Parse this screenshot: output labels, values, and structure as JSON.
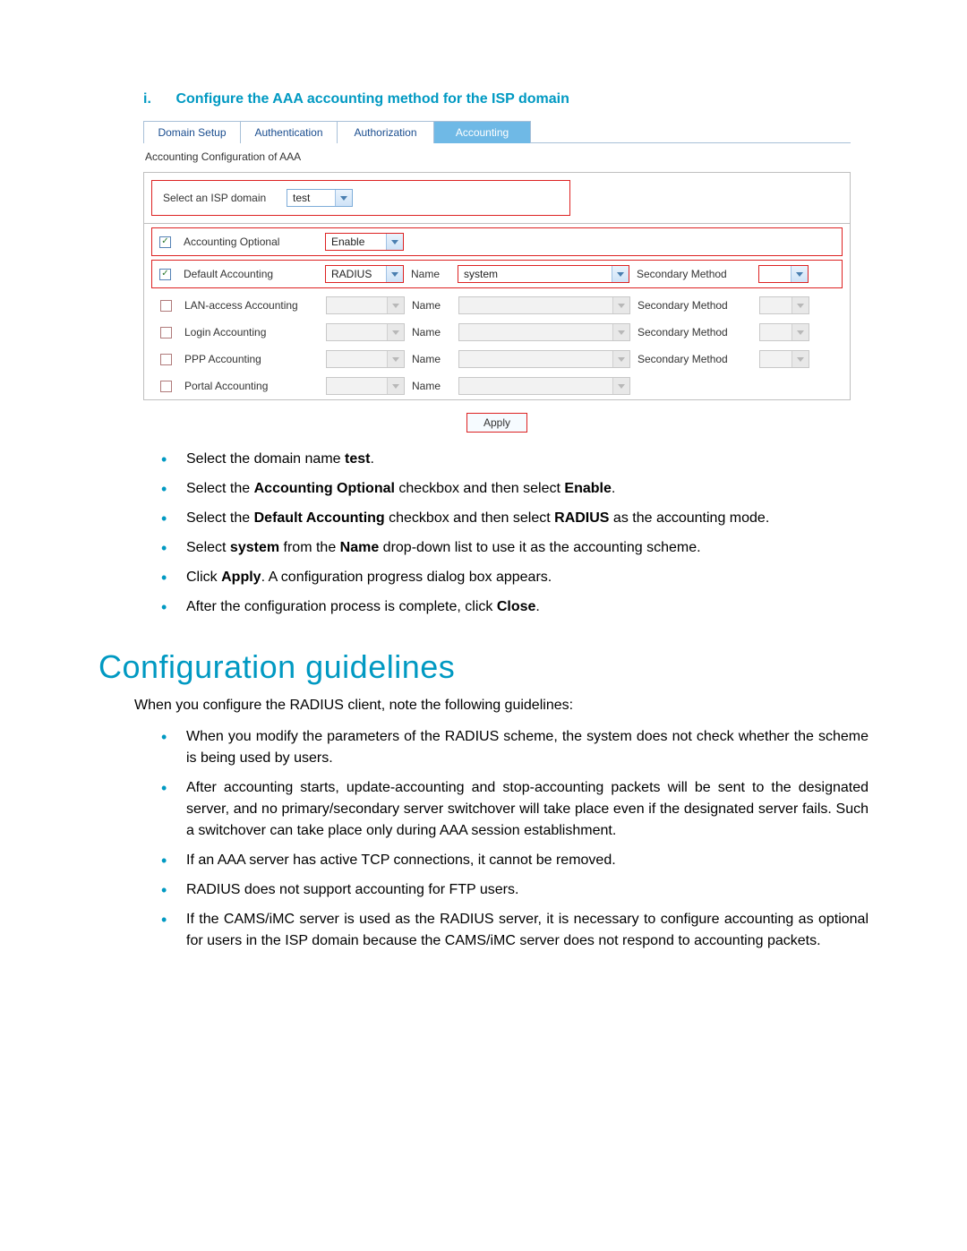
{
  "heading": {
    "index": "i.",
    "text": "Configure the AAA accounting method for the ISP domain"
  },
  "ui": {
    "tabs": [
      "Domain Setup",
      "Authentication",
      "Authorization",
      "Accounting"
    ],
    "active_tab_index": 3,
    "subtitle": "Accounting Configuration of AAA",
    "isp": {
      "label": "Select an ISP domain",
      "value": "test"
    },
    "name_label": "Name",
    "secondary_label": "Secondary Method",
    "rows": [
      {
        "checked": true,
        "label": "Accounting Optional",
        "method": "Enable",
        "has_name": false,
        "has_secondary": false,
        "red": true,
        "disabled": false
      },
      {
        "checked": true,
        "label": "Default Accounting",
        "method": "RADIUS",
        "has_name": true,
        "name_value": "system",
        "has_secondary": true,
        "sec_value": "",
        "red": true,
        "disabled": false
      },
      {
        "checked": false,
        "label": "LAN-access Accounting",
        "method": "",
        "has_name": true,
        "name_value": "",
        "has_secondary": true,
        "sec_value": "",
        "red": false,
        "disabled": true
      },
      {
        "checked": false,
        "label": "Login Accounting",
        "method": "",
        "has_name": true,
        "name_value": "",
        "has_secondary": true,
        "sec_value": "",
        "red": false,
        "disabled": true
      },
      {
        "checked": false,
        "label": "PPP Accounting",
        "method": "",
        "has_name": true,
        "name_value": "",
        "has_secondary": true,
        "sec_value": "",
        "red": false,
        "disabled": true
      },
      {
        "checked": false,
        "label": "Portal Accounting",
        "method": "",
        "has_name": true,
        "name_value": "",
        "has_secondary": false,
        "red": false,
        "disabled": true
      }
    ],
    "apply": "Apply"
  },
  "step_bullets": [
    "Select the domain name <b>test</b>.",
    "Select the <b>Accounting Optional</b> checkbox and then select <b>Enable</b>.",
    "Select the <b>Default Accounting</b> checkbox and then select <b>RADIUS</b> as the accounting mode.",
    "Select <b>system</b> from the <b>Name</b> drop-down list to use it as the accounting scheme.",
    "Click <b>Apply</b>. A configuration progress dialog box appears.",
    "After the configuration process is complete, click <b>Close</b>."
  ],
  "section_title": "Configuration guidelines",
  "section_intro": "When you configure the RADIUS client, note the following guidelines:",
  "guideline_bullets": [
    "When you modify the parameters of the RADIUS scheme, the system does not check whether the scheme is being used by users.",
    "After accounting starts, update-accounting and stop-accounting packets will be sent to the designated server, and no primary/secondary server switchover will take place even if the designated server fails. Such a switchover can take place only during AAA session establishment.",
    "If an AAA server has active TCP connections, it cannot be removed.",
    "RADIUS does not support accounting for FTP users.",
    "If the CAMS/iMC server is used as the RADIUS server, it is necessary to configure accounting as optional for users in the ISP domain because the CAMS/iMC server does not respond to accounting packets."
  ]
}
